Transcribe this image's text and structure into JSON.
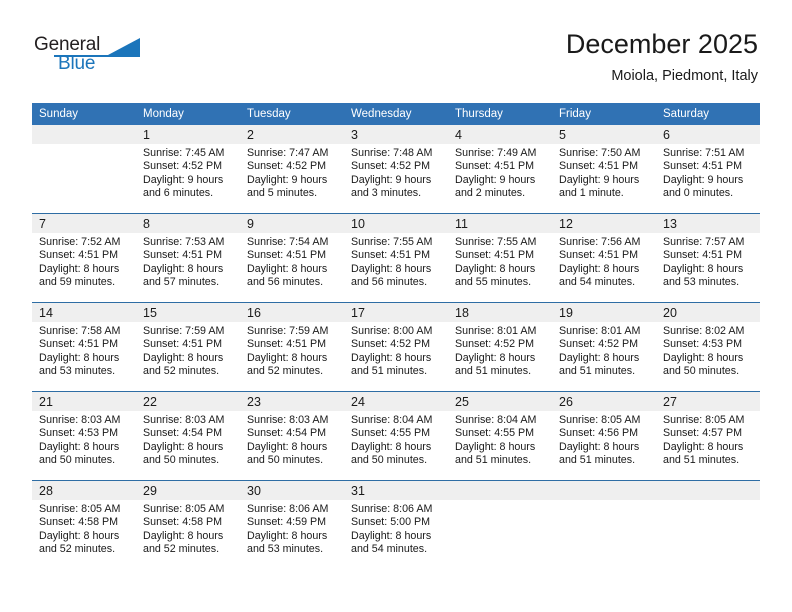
{
  "brand": {
    "name_part1": "General",
    "name_part2": "Blue",
    "accent_color": "#1b75bb"
  },
  "header": {
    "title": "December 2025",
    "subtitle": "Moiola, Piedmont, Italy"
  },
  "theme": {
    "header_blue": "#3072b4",
    "rule_blue": "#2e6da4",
    "daynum_gray": "#efefef"
  },
  "weekday_headers": [
    "Sunday",
    "Monday",
    "Tuesday",
    "Wednesday",
    "Thursday",
    "Friday",
    "Saturday"
  ],
  "weeks": [
    [
      {
        "day": "",
        "empty": true,
        "sunrise": "",
        "sunset": "",
        "daylight_line1": "",
        "daylight_line2": ""
      },
      {
        "day": "1",
        "sunrise": "Sunrise: 7:45 AM",
        "sunset": "Sunset: 4:52 PM",
        "daylight_line1": "Daylight: 9 hours",
        "daylight_line2": "and 6 minutes."
      },
      {
        "day": "2",
        "sunrise": "Sunrise: 7:47 AM",
        "sunset": "Sunset: 4:52 PM",
        "daylight_line1": "Daylight: 9 hours",
        "daylight_line2": "and 5 minutes."
      },
      {
        "day": "3",
        "sunrise": "Sunrise: 7:48 AM",
        "sunset": "Sunset: 4:52 PM",
        "daylight_line1": "Daylight: 9 hours",
        "daylight_line2": "and 3 minutes."
      },
      {
        "day": "4",
        "sunrise": "Sunrise: 7:49 AM",
        "sunset": "Sunset: 4:51 PM",
        "daylight_line1": "Daylight: 9 hours",
        "daylight_line2": "and 2 minutes."
      },
      {
        "day": "5",
        "sunrise": "Sunrise: 7:50 AM",
        "sunset": "Sunset: 4:51 PM",
        "daylight_line1": "Daylight: 9 hours",
        "daylight_line2": "and 1 minute."
      },
      {
        "day": "6",
        "sunrise": "Sunrise: 7:51 AM",
        "sunset": "Sunset: 4:51 PM",
        "daylight_line1": "Daylight: 9 hours",
        "daylight_line2": "and 0 minutes."
      }
    ],
    [
      {
        "day": "7",
        "sunrise": "Sunrise: 7:52 AM",
        "sunset": "Sunset: 4:51 PM",
        "daylight_line1": "Daylight: 8 hours",
        "daylight_line2": "and 59 minutes."
      },
      {
        "day": "8",
        "sunrise": "Sunrise: 7:53 AM",
        "sunset": "Sunset: 4:51 PM",
        "daylight_line1": "Daylight: 8 hours",
        "daylight_line2": "and 57 minutes."
      },
      {
        "day": "9",
        "sunrise": "Sunrise: 7:54 AM",
        "sunset": "Sunset: 4:51 PM",
        "daylight_line1": "Daylight: 8 hours",
        "daylight_line2": "and 56 minutes."
      },
      {
        "day": "10",
        "sunrise": "Sunrise: 7:55 AM",
        "sunset": "Sunset: 4:51 PM",
        "daylight_line1": "Daylight: 8 hours",
        "daylight_line2": "and 56 minutes."
      },
      {
        "day": "11",
        "sunrise": "Sunrise: 7:55 AM",
        "sunset": "Sunset: 4:51 PM",
        "daylight_line1": "Daylight: 8 hours",
        "daylight_line2": "and 55 minutes."
      },
      {
        "day": "12",
        "sunrise": "Sunrise: 7:56 AM",
        "sunset": "Sunset: 4:51 PM",
        "daylight_line1": "Daylight: 8 hours",
        "daylight_line2": "and 54 minutes."
      },
      {
        "day": "13",
        "sunrise": "Sunrise: 7:57 AM",
        "sunset": "Sunset: 4:51 PM",
        "daylight_line1": "Daylight: 8 hours",
        "daylight_line2": "and 53 minutes."
      }
    ],
    [
      {
        "day": "14",
        "sunrise": "Sunrise: 7:58 AM",
        "sunset": "Sunset: 4:51 PM",
        "daylight_line1": "Daylight: 8 hours",
        "daylight_line2": "and 53 minutes."
      },
      {
        "day": "15",
        "sunrise": "Sunrise: 7:59 AM",
        "sunset": "Sunset: 4:51 PM",
        "daylight_line1": "Daylight: 8 hours",
        "daylight_line2": "and 52 minutes."
      },
      {
        "day": "16",
        "sunrise": "Sunrise: 7:59 AM",
        "sunset": "Sunset: 4:51 PM",
        "daylight_line1": "Daylight: 8 hours",
        "daylight_line2": "and 52 minutes."
      },
      {
        "day": "17",
        "sunrise": "Sunrise: 8:00 AM",
        "sunset": "Sunset: 4:52 PM",
        "daylight_line1": "Daylight: 8 hours",
        "daylight_line2": "and 51 minutes."
      },
      {
        "day": "18",
        "sunrise": "Sunrise: 8:01 AM",
        "sunset": "Sunset: 4:52 PM",
        "daylight_line1": "Daylight: 8 hours",
        "daylight_line2": "and 51 minutes."
      },
      {
        "day": "19",
        "sunrise": "Sunrise: 8:01 AM",
        "sunset": "Sunset: 4:52 PM",
        "daylight_line1": "Daylight: 8 hours",
        "daylight_line2": "and 51 minutes."
      },
      {
        "day": "20",
        "sunrise": "Sunrise: 8:02 AM",
        "sunset": "Sunset: 4:53 PM",
        "daylight_line1": "Daylight: 8 hours",
        "daylight_line2": "and 50 minutes."
      }
    ],
    [
      {
        "day": "21",
        "sunrise": "Sunrise: 8:03 AM",
        "sunset": "Sunset: 4:53 PM",
        "daylight_line1": "Daylight: 8 hours",
        "daylight_line2": "and 50 minutes."
      },
      {
        "day": "22",
        "sunrise": "Sunrise: 8:03 AM",
        "sunset": "Sunset: 4:54 PM",
        "daylight_line1": "Daylight: 8 hours",
        "daylight_line2": "and 50 minutes."
      },
      {
        "day": "23",
        "sunrise": "Sunrise: 8:03 AM",
        "sunset": "Sunset: 4:54 PM",
        "daylight_line1": "Daylight: 8 hours",
        "daylight_line2": "and 50 minutes."
      },
      {
        "day": "24",
        "sunrise": "Sunrise: 8:04 AM",
        "sunset": "Sunset: 4:55 PM",
        "daylight_line1": "Daylight: 8 hours",
        "daylight_line2": "and 50 minutes."
      },
      {
        "day": "25",
        "sunrise": "Sunrise: 8:04 AM",
        "sunset": "Sunset: 4:55 PM",
        "daylight_line1": "Daylight: 8 hours",
        "daylight_line2": "and 51 minutes."
      },
      {
        "day": "26",
        "sunrise": "Sunrise: 8:05 AM",
        "sunset": "Sunset: 4:56 PM",
        "daylight_line1": "Daylight: 8 hours",
        "daylight_line2": "and 51 minutes."
      },
      {
        "day": "27",
        "sunrise": "Sunrise: 8:05 AM",
        "sunset": "Sunset: 4:57 PM",
        "daylight_line1": "Daylight: 8 hours",
        "daylight_line2": "and 51 minutes."
      }
    ],
    [
      {
        "day": "28",
        "sunrise": "Sunrise: 8:05 AM",
        "sunset": "Sunset: 4:58 PM",
        "daylight_line1": "Daylight: 8 hours",
        "daylight_line2": "and 52 minutes."
      },
      {
        "day": "29",
        "sunrise": "Sunrise: 8:05 AM",
        "sunset": "Sunset: 4:58 PM",
        "daylight_line1": "Daylight: 8 hours",
        "daylight_line2": "and 52 minutes."
      },
      {
        "day": "30",
        "sunrise": "Sunrise: 8:06 AM",
        "sunset": "Sunset: 4:59 PM",
        "daylight_line1": "Daylight: 8 hours",
        "daylight_line2": "and 53 minutes."
      },
      {
        "day": "31",
        "sunrise": "Sunrise: 8:06 AM",
        "sunset": "Sunset: 5:00 PM",
        "daylight_line1": "Daylight: 8 hours",
        "daylight_line2": "and 54 minutes."
      },
      {
        "day": "",
        "empty": true,
        "sunrise": "",
        "sunset": "",
        "daylight_line1": "",
        "daylight_line2": ""
      },
      {
        "day": "",
        "empty": true,
        "sunrise": "",
        "sunset": "",
        "daylight_line1": "",
        "daylight_line2": ""
      },
      {
        "day": "",
        "empty": true,
        "sunrise": "",
        "sunset": "",
        "daylight_line1": "",
        "daylight_line2": ""
      }
    ]
  ]
}
